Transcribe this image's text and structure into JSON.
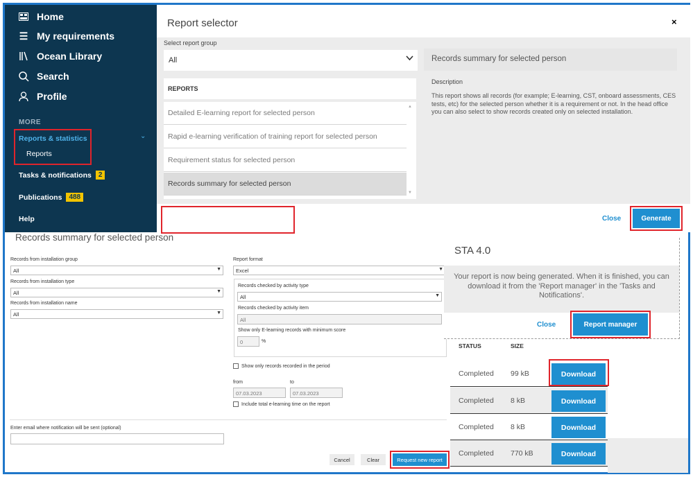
{
  "sidebar": {
    "nav": [
      {
        "label": "Home",
        "icon": "dashboard-icon"
      },
      {
        "label": "My requirements",
        "icon": "list-icon"
      },
      {
        "label": "Ocean Library",
        "icon": "library-icon"
      },
      {
        "label": "Search",
        "icon": "search-icon"
      },
      {
        "label": "Profile",
        "icon": "user-icon"
      }
    ],
    "more_label": "MORE",
    "reports_statistics": "Reports & statistics",
    "reports_sub": "Reports",
    "tasks_label": "Tasks & notifications",
    "tasks_badge": "2",
    "publications_label": "Publications",
    "publications_badge": "488",
    "help_label": "Help"
  },
  "report_selector": {
    "title": "Report selector",
    "close_x": "×",
    "group_label": "Select report group",
    "group_value": "All",
    "reports_header": "REPORTS",
    "reports": [
      "Detailed E-learning report for selected person",
      "Rapid e-learning verification of training report for selected person",
      "Requirement status for selected person",
      "Records summary for selected person"
    ],
    "detail_title": "Records summary for selected person",
    "description_label": "Description",
    "description_text": "This report shows all records (for example; E-learning, CST, onboard assessments, CES tests, etc) for the selected person whether it is a requirement or not. In the head office you can also select to show records created only on selected installation.",
    "close_label": "Close",
    "generate_label": "Generate"
  },
  "form": {
    "title": "Records summary for selected person",
    "installation_group_label": "Records from installation group",
    "installation_group_value": "All",
    "installation_type_label": "Records from installation type",
    "installation_type_value": "All",
    "installation_name_label": "Records from installation name",
    "installation_name_value": "All",
    "report_format_label": "Report format",
    "report_format_value": "Excel",
    "activity_type_label": "Records checked by activity type",
    "activity_type_value": "All",
    "activity_item_label": "Records checked by activity item",
    "activity_item_value": "All",
    "min_score_label": "Show only E-learning records with minimum score",
    "min_score_value": "0",
    "min_score_unit": "%",
    "period_checkbox": "Show only records recorded in the period",
    "from_label": "from",
    "from_value": "07.03.2023",
    "to_label": "to",
    "to_value": "07.03.2023",
    "total_time_checkbox": "Include total e-learning time on the report",
    "email_label": "Enter email where notification will be sent (optional)",
    "cancel_label": "Cancel",
    "clear_label": "Clear",
    "request_label": "Request new report"
  },
  "sta_popup": {
    "title": "STA 4.0",
    "message": "Your report is now being generated. When it is finished, you can download it from the 'Report manager' in the 'Tasks and Notifications'.",
    "close_label": "Close",
    "report_manager_label": "Report manager"
  },
  "status_table": {
    "headers": {
      "status": "STATUS",
      "size": "SIZE"
    },
    "rows": [
      {
        "status": "Completed",
        "size": "99 kB",
        "action": "Download"
      },
      {
        "status": "Completed",
        "size": "8 kB",
        "action": "Download"
      },
      {
        "status": "Completed",
        "size": "8 kB",
        "action": "Download"
      },
      {
        "status": "Completed",
        "size": "770 kB",
        "action": "Download"
      }
    ]
  },
  "colors": {
    "sidebar_bg": "#0d3650",
    "accent_blue": "#1f8fd0",
    "highlight_red": "#e0242b",
    "badge_yellow": "#f2c400"
  }
}
